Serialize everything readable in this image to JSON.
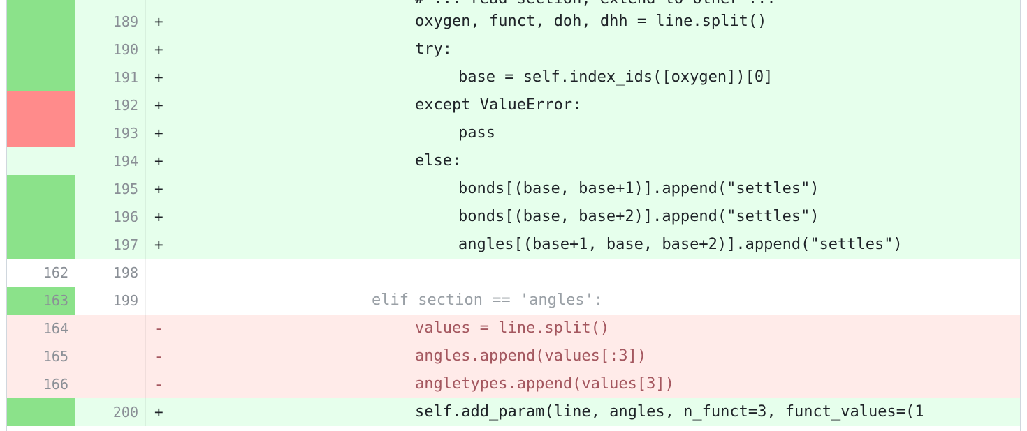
{
  "top_partial_text": "# ... read section, extend to other ...",
  "rows": [
    {
      "old": "",
      "new": "189",
      "marker": "+",
      "code": "oxygen, funct, doh, dhh = line.split()",
      "indent": 5
    },
    {
      "old": "",
      "new": "190",
      "marker": "+",
      "code": "try:",
      "indent": 5
    },
    {
      "old": "",
      "new": "191",
      "marker": "+",
      "code": "base = self.index_ids([oxygen])[0]",
      "indent": 6
    },
    {
      "old": "",
      "new": "192",
      "marker": "+",
      "code": "except ValueError:",
      "indent": 5
    },
    {
      "old": "",
      "new": "193",
      "marker": "+",
      "code": "pass",
      "indent": 6
    },
    {
      "old": "",
      "new": "194",
      "marker": "+",
      "code": "else:",
      "indent": 5
    },
    {
      "old": "",
      "new": "195",
      "marker": "+",
      "code": "bonds[(base, base+1)].append(\"settles\")",
      "indent": 6
    },
    {
      "old": "",
      "new": "196",
      "marker": "+",
      "code": "bonds[(base, base+2)].append(\"settles\")",
      "indent": 6
    },
    {
      "old": "",
      "new": "197",
      "marker": "+",
      "code": "angles[(base+1, base, base+2)].append(\"settles\")",
      "indent": 6
    },
    {
      "old": "162",
      "new": "198",
      "marker": "",
      "code": "",
      "indent": 4
    },
    {
      "old": "163",
      "new": "199",
      "marker": "",
      "code": "elif section == 'angles':",
      "indent": 4
    },
    {
      "old": "164",
      "new": "",
      "marker": "-",
      "code": "values = line.split()",
      "indent": 5
    },
    {
      "old": "165",
      "new": "",
      "marker": "-",
      "code": "angles.append(values[:3])",
      "indent": 5
    },
    {
      "old": "166",
      "new": "",
      "marker": "-",
      "code": "angletypes.append(values[3])",
      "indent": 5
    },
    {
      "old": "",
      "new": "200",
      "marker": "+",
      "code": "self.add_param(line, angles, n_funct=3, funct_values=(1",
      "indent": 5
    }
  ],
  "colors": {
    "added_bg": "#e6ffec",
    "deleted_bg": "#ffebe9",
    "covered": "#8be28a",
    "uncovered": "#ff8b8b"
  }
}
